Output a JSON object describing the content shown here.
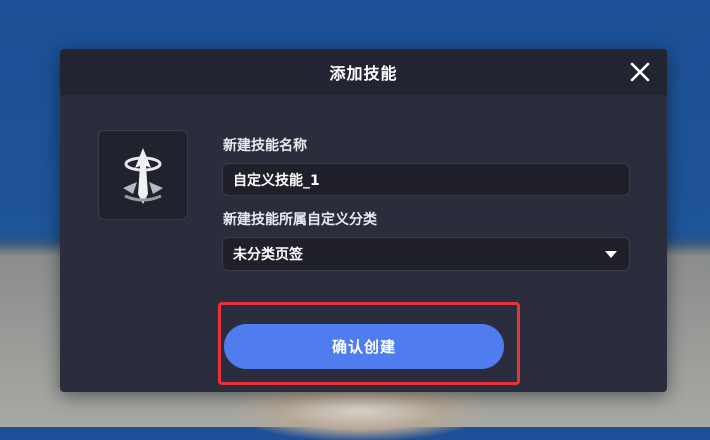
{
  "dialog": {
    "title": "添加技能",
    "close_icon": "close-icon",
    "skill_icon": "skill-emblem-icon",
    "name_label": "新建技能名称",
    "name_value": "自定义技能_1",
    "category_label": "新建技能所属自定义分类",
    "category_value": "未分类页签",
    "confirm_label": "确认创建"
  },
  "colors": {
    "dialog_bg": "#2b2d3c",
    "header_bg": "#222431",
    "accent": "#4f7df0",
    "highlight": "#e8323c"
  }
}
